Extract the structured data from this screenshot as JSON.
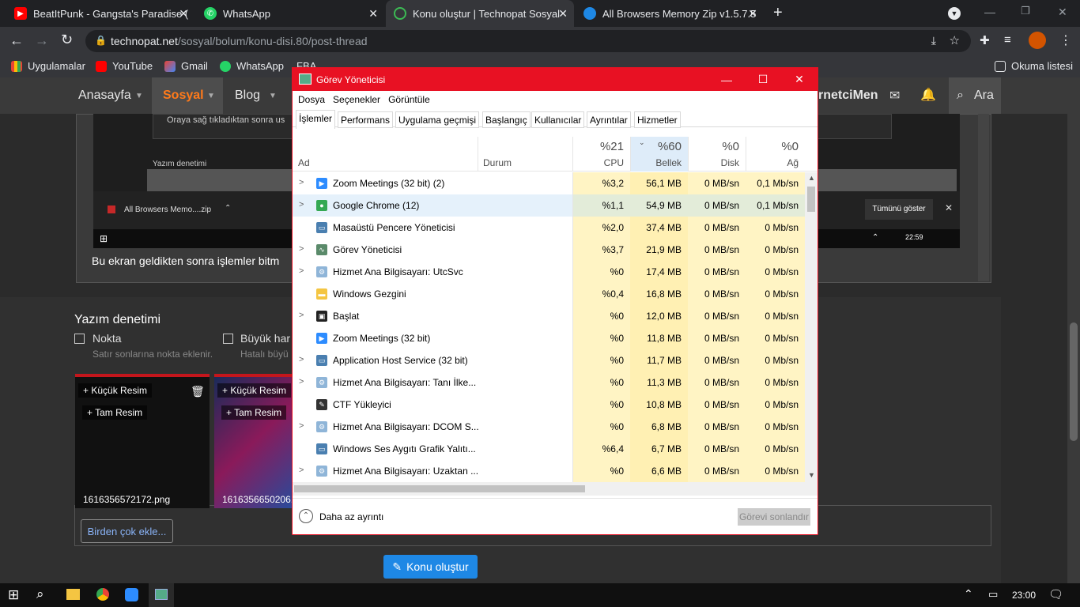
{
  "browser": {
    "tabs": [
      {
        "title": "BeatItPunk - Gangsta's Paradise (",
        "color": "#ff0000"
      },
      {
        "title": "WhatsApp",
        "color": "#25d366"
      },
      {
        "title": "Konu oluştur | Technopat Sosyal",
        "color": "#3cba54"
      },
      {
        "title": "All Browsers Memory Zip v1.5.7.5",
        "color": "#1e88e5"
      }
    ],
    "url_host": "technopat.net",
    "url_path": "/sosyal/bolum/konu-disi.80/post-thread",
    "bookmarks": [
      "Uygulamalar",
      "YouTube",
      "Gmail",
      "WhatsApp",
      "FBA"
    ],
    "reading_list": "Okuma listesi"
  },
  "site": {
    "nav": [
      "Anasayfa",
      "Sosyal",
      "Blog"
    ],
    "user": "rnetciMen",
    "search": "Ara",
    "editor_hint": "Oraya sağ tıkladıktan sonra us",
    "editor_text": "Bu ekran geldikten sonra işlemler bitm",
    "spell_title": "Yazım denetimi",
    "nested_spell": "Yazım denetimi",
    "opt1_label": "Nokta",
    "opt1_desc": "Satır sonlarına nokta eklenir.",
    "opt2_label": "Büyük har",
    "opt2_desc": "Hatalı büyü",
    "thumb_small": "+ Küçük Resim",
    "thumb_full": "+ Tam Resim",
    "file1": "1616356572172.png",
    "file2": "1616356650206.",
    "multi": "Birden çok ekle...",
    "post": "Konu oluştur",
    "download_name": "All Browsers Memo....zip",
    "show_all": "Tümünü göster",
    "inner_clock": "22:59"
  },
  "taskbar": {
    "clock": "23:00"
  },
  "taskmgr": {
    "title": "Görev Yöneticisi",
    "menu": [
      "Dosya",
      "Seçenekler",
      "Görüntüle"
    ],
    "tabs": [
      "İşlemler",
      "Performans",
      "Uygulama geçmişi",
      "Başlangıç",
      "Kullanıcılar",
      "Ayrıntılar",
      "Hizmetler"
    ],
    "headers": {
      "name": "Ad",
      "status": "Durum",
      "cpu_pct": "%21",
      "cpu": "CPU",
      "mem_pct": "%60",
      "mem": "Bellek",
      "disk_pct": "%0",
      "disk": "Disk",
      "net_pct": "%0",
      "net": "Ağ"
    },
    "processes": [
      {
        "name": "Zoom Meetings (32 bit) (2)",
        "cpu": "%3,2",
        "mem": "56,1 MB",
        "disk": "0 MB/sn",
        "net": "0,1 Mb/sn",
        "expand": true,
        "icon": "zoom-icon"
      },
      {
        "name": "Google Chrome (12)",
        "cpu": "%1,1",
        "mem": "54,9 MB",
        "disk": "0 MB/sn",
        "net": "0,1 Mb/sn",
        "expand": true,
        "icon": "chrome-icon"
      },
      {
        "name": "Masaüstü Pencere Yöneticisi",
        "cpu": "%2,0",
        "mem": "37,4 MB",
        "disk": "0 MB/sn",
        "net": "0 Mb/sn",
        "expand": false,
        "icon": "window-icon"
      },
      {
        "name": "Görev Yöneticisi",
        "cpu": "%3,7",
        "mem": "21,9 MB",
        "disk": "0 MB/sn",
        "net": "0 Mb/sn",
        "expand": true,
        "icon": "taskmgr-icon"
      },
      {
        "name": "Hizmet Ana Bilgisayarı: UtcSvc",
        "cpu": "%0",
        "mem": "17,4 MB",
        "disk": "0 MB/sn",
        "net": "0 Mb/sn",
        "expand": true,
        "icon": "gear-icon"
      },
      {
        "name": "Windows Gezgini",
        "cpu": "%0,4",
        "mem": "16,8 MB",
        "disk": "0 MB/sn",
        "net": "0 Mb/sn",
        "expand": false,
        "icon": "folder-icon"
      },
      {
        "name": "Başlat",
        "cpu": "%0",
        "mem": "12,0 MB",
        "disk": "0 MB/sn",
        "net": "0 Mb/sn",
        "expand": true,
        "icon": "start-icon"
      },
      {
        "name": "Zoom Meetings (32 bit)",
        "cpu": "%0",
        "mem": "11,8 MB",
        "disk": "0 MB/sn",
        "net": "0 Mb/sn",
        "expand": false,
        "icon": "zoom-icon"
      },
      {
        "name": "Application Host Service (32 bit)",
        "cpu": "%0",
        "mem": "11,7 MB",
        "disk": "0 MB/sn",
        "net": "0 Mb/sn",
        "expand": true,
        "icon": "window-icon"
      },
      {
        "name": "Hizmet Ana Bilgisayarı: Tanı İlke...",
        "cpu": "%0",
        "mem": "11,3 MB",
        "disk": "0 MB/sn",
        "net": "0 Mb/sn",
        "expand": true,
        "icon": "gear-icon"
      },
      {
        "name": "CTF Yükleyici",
        "cpu": "%0",
        "mem": "10,8 MB",
        "disk": "0 MB/sn",
        "net": "0 Mb/sn",
        "expand": false,
        "icon": "pen-icon"
      },
      {
        "name": "Hizmet Ana Bilgisayarı: DCOM S...",
        "cpu": "%0",
        "mem": "6,8 MB",
        "disk": "0 MB/sn",
        "net": "0 Mb/sn",
        "expand": true,
        "icon": "gear-icon"
      },
      {
        "name": "Windows Ses Aygıtı Grafik Yalıtı...",
        "cpu": "%6,4",
        "mem": "6,7 MB",
        "disk": "0 MB/sn",
        "net": "0 Mb/sn",
        "expand": false,
        "icon": "window-icon"
      },
      {
        "name": "Hizmet Ana Bilgisayarı: Uzaktan ...",
        "cpu": "%0",
        "mem": "6,6 MB",
        "disk": "0 MB/sn",
        "net": "0 Mb/sn",
        "expand": true,
        "icon": "gear-icon"
      }
    ],
    "fewer_details": "Daha az ayrıntı",
    "end_task": "Görevi sonlandır"
  }
}
